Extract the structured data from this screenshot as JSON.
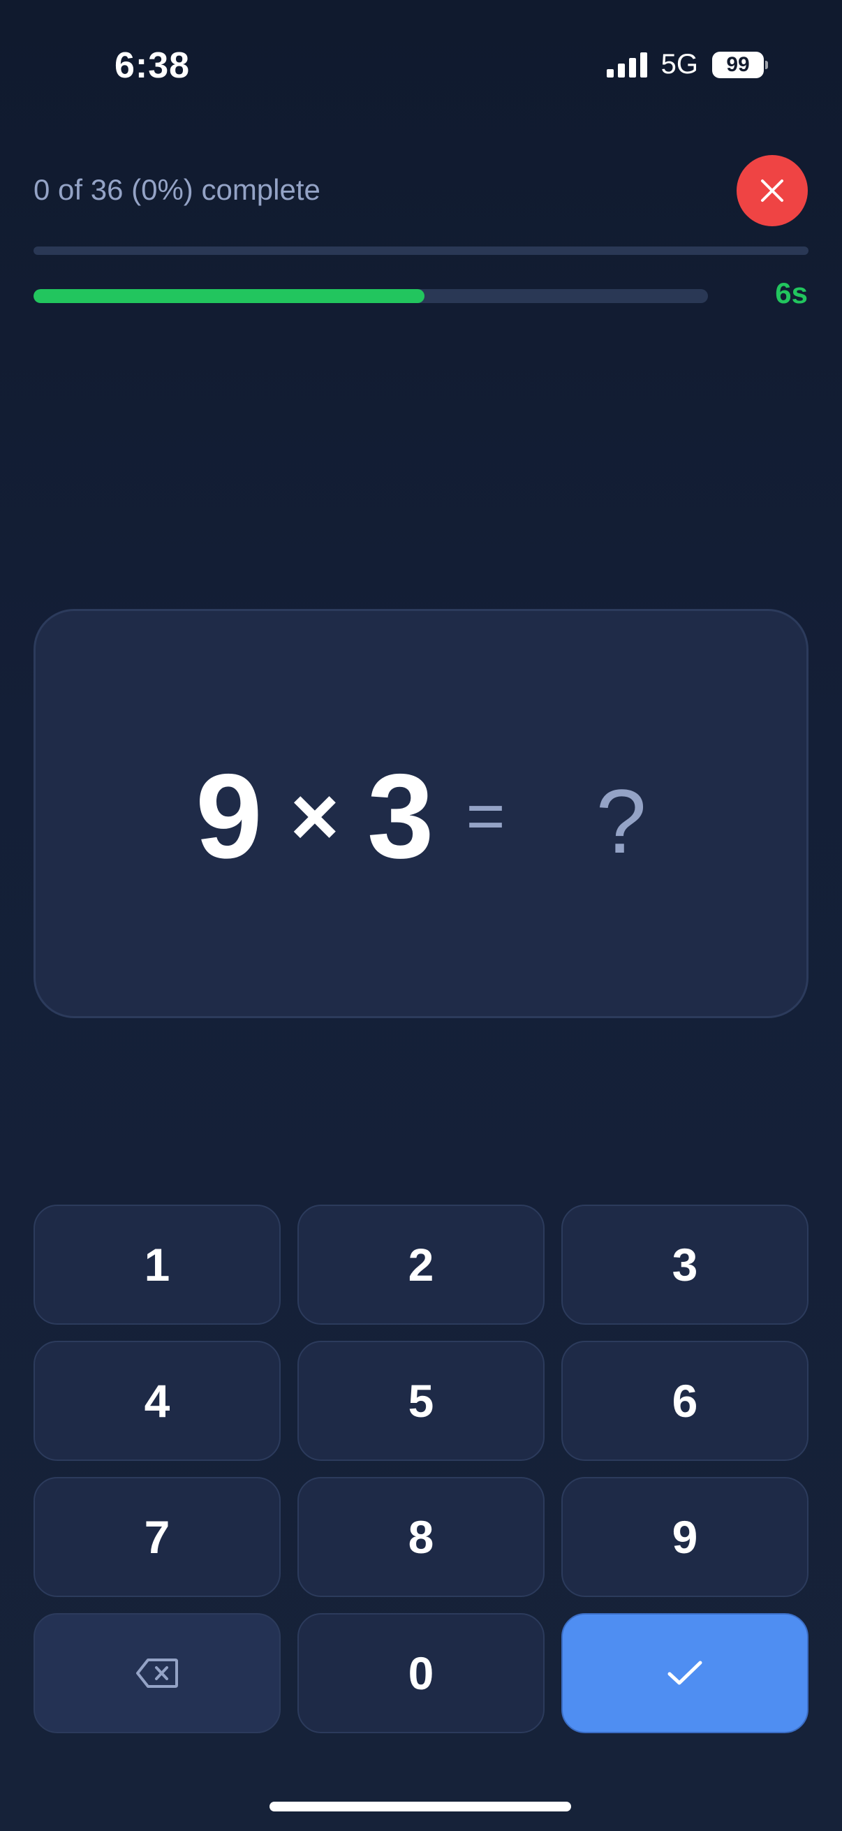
{
  "status_bar": {
    "time": "6:38",
    "network": "5G",
    "battery": "99"
  },
  "header": {
    "progress_text": "0 of 36 (0%) complete",
    "progress_fraction": 0.0,
    "timer_label": "6s",
    "timer_fraction": 0.58
  },
  "question": {
    "operand_a": "9",
    "operator": "×",
    "operand_b": "3",
    "equals": "=",
    "answer_placeholder": "?"
  },
  "keypad": {
    "k1": "1",
    "k2": "2",
    "k3": "3",
    "k4": "4",
    "k5": "5",
    "k6": "6",
    "k7": "7",
    "k8": "8",
    "k9": "9",
    "k0": "0",
    "backspace_icon": "backspace-icon",
    "submit_icon": "check-icon"
  },
  "colors": {
    "background": "#111a2e",
    "accent_green": "#22c55e",
    "close_red": "#ef4444",
    "submit_blue": "#4f8ef2",
    "muted_text": "#94a3c6"
  }
}
